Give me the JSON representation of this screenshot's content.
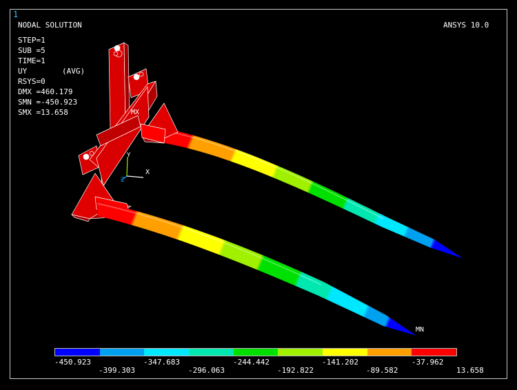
{
  "window_number": "1",
  "title": "NODAL SOLUTION",
  "product": "ANSYS 10.0",
  "info": [
    {
      "label": "STEP=1",
      "value": ""
    },
    {
      "label": "SUB =5",
      "value": ""
    },
    {
      "label": "TIME=1",
      "value": ""
    },
    {
      "label": "UY",
      "value": "(AVG)"
    },
    {
      "label": "RSYS=0",
      "value": ""
    },
    {
      "label": "DMX =460.179",
      "value": ""
    },
    {
      "label": "SMN =-450.923",
      "value": ""
    },
    {
      "label": "SMX =13.658",
      "value": ""
    }
  ],
  "markers": {
    "max": "MX",
    "min": "MN"
  },
  "triad": {
    "x": "X",
    "y": "Y",
    "z": "Z"
  },
  "legend": {
    "colors": [
      "#0000ff",
      "#00a0f0",
      "#00e8ff",
      "#00e8b0",
      "#00e000",
      "#a0f000",
      "#ffff00",
      "#ffa000",
      "#ff0000"
    ],
    "values_bottom": [
      "-450.923",
      "-347.683",
      "-244.442",
      "-141.202",
      "-37.962"
    ],
    "values_top": [
      "-399.303",
      "-296.063",
      "-192.822",
      "-89.582",
      "13.658"
    ]
  }
}
